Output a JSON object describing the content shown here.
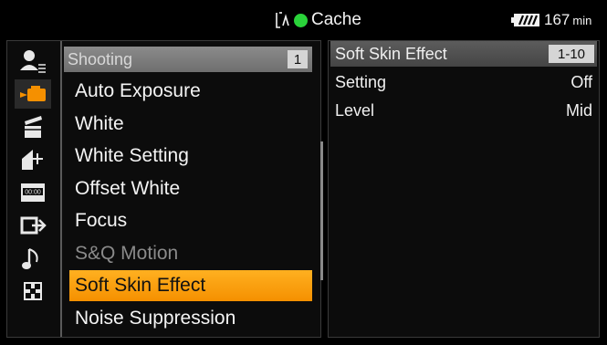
{
  "status_bar": {
    "media_label": "Cache",
    "battery_minutes": "167",
    "battery_unit": "min",
    "record_dot_color": "#2ad33a"
  },
  "side_icons": [
    {
      "name": "user-menu-icon",
      "active": false
    },
    {
      "name": "camera-icon",
      "active": true
    },
    {
      "name": "clapperboard-icon",
      "active": false
    },
    {
      "name": "tc-edit-icon",
      "active": false
    },
    {
      "name": "timecode-icon",
      "active": false
    },
    {
      "name": "output-icon",
      "active": false
    },
    {
      "name": "audio-note-icon",
      "active": false
    },
    {
      "name": "system-grid-icon",
      "active": false
    }
  ],
  "menu": {
    "title": "Shooting",
    "page": "1",
    "items": [
      {
        "label": "Auto Exposure",
        "state": "normal"
      },
      {
        "label": "White",
        "state": "normal"
      },
      {
        "label": "White Setting",
        "state": "normal"
      },
      {
        "label": "Offset White",
        "state": "normal"
      },
      {
        "label": "Focus",
        "state": "normal"
      },
      {
        "label": "S&Q Motion",
        "state": "disabled"
      },
      {
        "label": "Soft Skin Effect",
        "state": "selected"
      },
      {
        "label": "Noise Suppression",
        "state": "normal"
      }
    ]
  },
  "detail": {
    "title": "Soft Skin Effect",
    "range": "1-10",
    "settings": [
      {
        "label": "Setting",
        "value": "Off"
      },
      {
        "label": "Level",
        "value": "Mid"
      }
    ]
  },
  "colors": {
    "accent": "#f59000",
    "active_green": "#2ad33a"
  }
}
